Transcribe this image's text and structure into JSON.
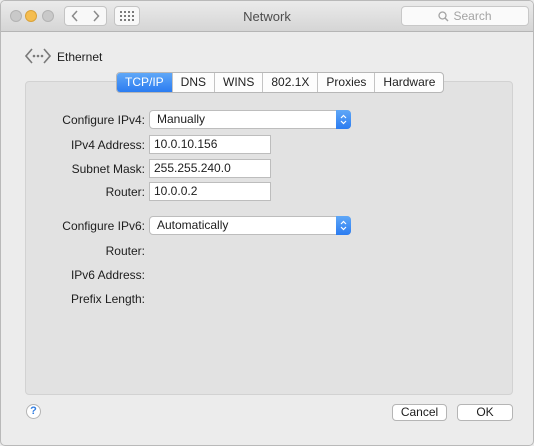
{
  "window": {
    "title": "Network"
  },
  "toolbar": {
    "search_placeholder": "Search"
  },
  "header": {
    "title": "Ethernet"
  },
  "tabs": [
    {
      "label": "TCP/IP",
      "active": true
    },
    {
      "label": "DNS"
    },
    {
      "label": "WINS"
    },
    {
      "label": "802.1X"
    },
    {
      "label": "Proxies"
    },
    {
      "label": "Hardware"
    }
  ],
  "ipv4": {
    "configure_label": "Configure IPv4:",
    "configure_value": "Manually",
    "address_label": "IPv4 Address:",
    "address_value": "10.0.10.156",
    "subnet_label": "Subnet Mask:",
    "subnet_value": "255.255.240.0",
    "router_label": "Router:",
    "router_value": "10.0.0.2"
  },
  "ipv6": {
    "configure_label": "Configure IPv6:",
    "configure_value": "Automatically",
    "router_label": "Router:",
    "address_label": "IPv6 Address:",
    "prefix_label": "Prefix Length:"
  },
  "footer": {
    "help": "?",
    "cancel": "Cancel",
    "ok": "OK"
  },
  "colors": {
    "accent": "#2b7cf1",
    "background": "#ececec"
  }
}
